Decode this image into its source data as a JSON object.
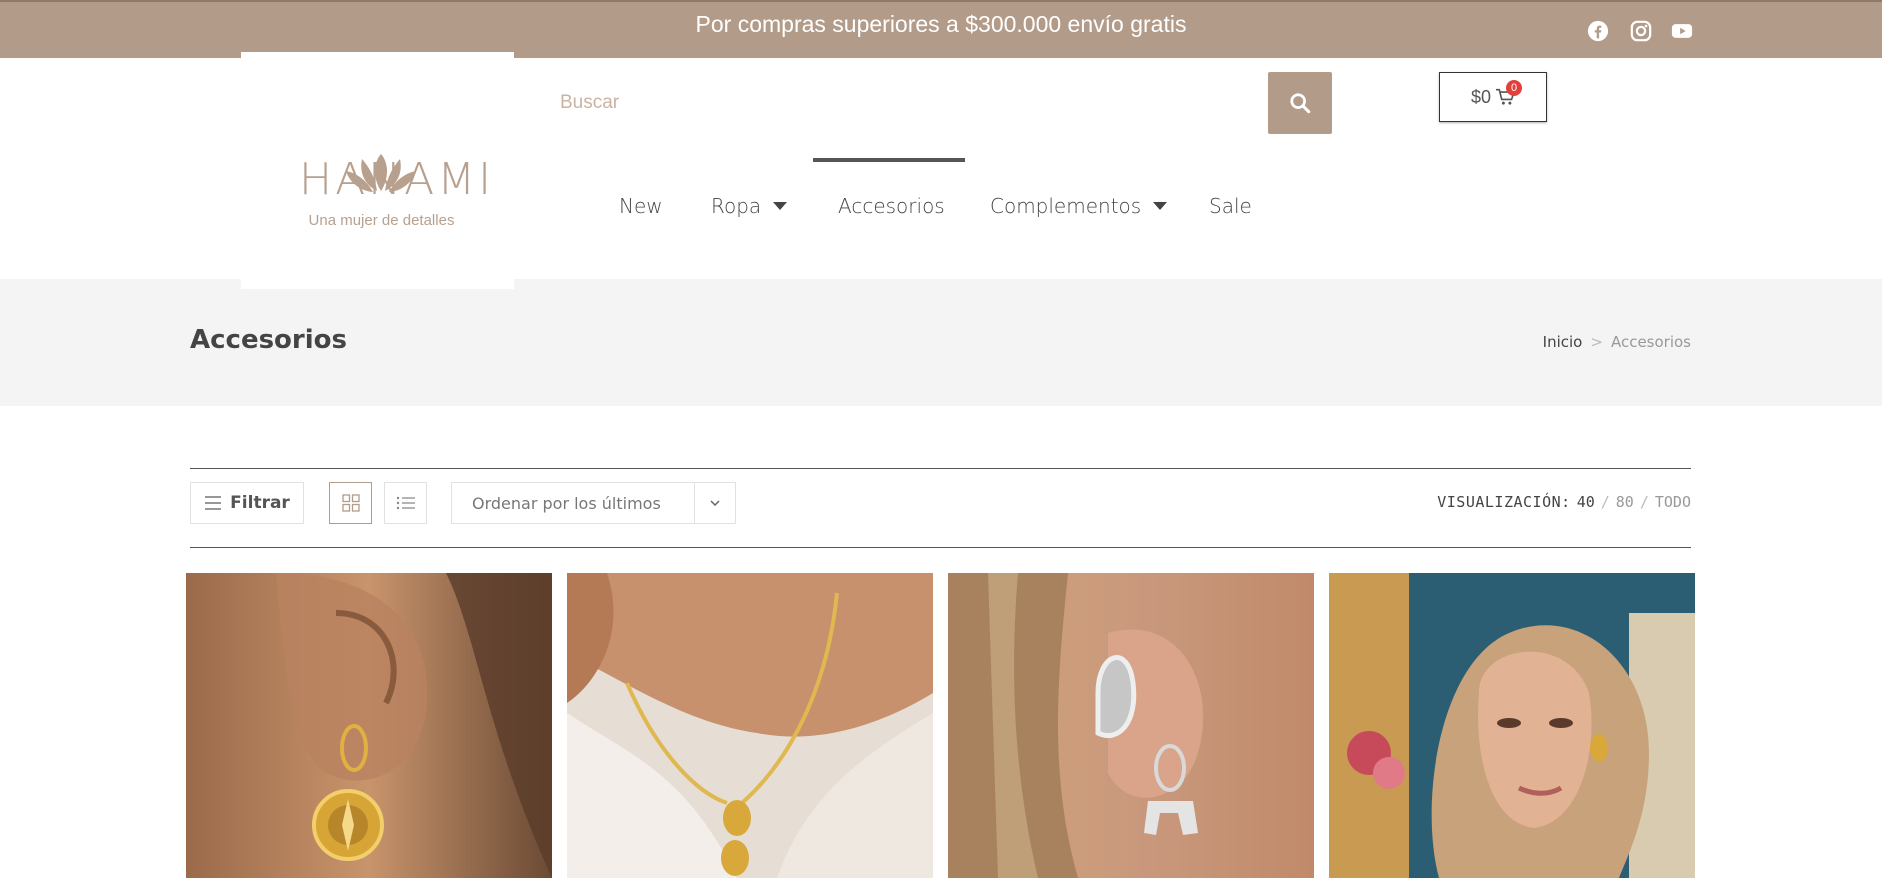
{
  "topbar": {
    "message": "Por compras superiores a $300.000 envío gratis",
    "social": [
      "facebook-icon",
      "instagram-icon",
      "youtube-icon"
    ],
    "bg_color": "#b39b89"
  },
  "brand": {
    "name": "HANAMI",
    "tagline": "Una mujer de detalles",
    "color": "#b8a08e"
  },
  "search": {
    "placeholder": "Buscar"
  },
  "cart": {
    "amount": "$0",
    "count": "0"
  },
  "nav": {
    "items": [
      {
        "label": "New",
        "dropdown": false
      },
      {
        "label": "Ropa",
        "dropdown": true
      },
      {
        "label": "Accesorios",
        "dropdown": false,
        "active": true
      },
      {
        "label": "Complementos",
        "dropdown": true
      },
      {
        "label": "Sale",
        "dropdown": false
      }
    ]
  },
  "page": {
    "title": "Accesorios",
    "breadcrumb": {
      "home": "Inicio",
      "separator": ">",
      "current": "Accesorios"
    }
  },
  "toolbar": {
    "filter_label": "Filtrar",
    "sort_label": "Ordenar por los últimos",
    "view_label": "VISUALIZACIÓN:",
    "view_options": [
      "40",
      "80",
      "TODO"
    ],
    "view_separator": "/"
  },
  "products": [
    {
      "alt": "gold-compass-earring-photo"
    },
    {
      "alt": "gold-necklace-photo"
    },
    {
      "alt": "silver-ear-cuff-photo"
    },
    {
      "alt": "model-gold-earring-photo"
    }
  ]
}
